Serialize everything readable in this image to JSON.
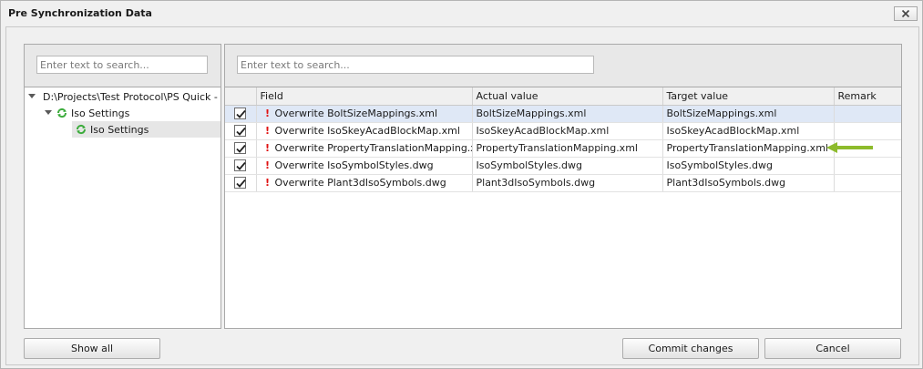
{
  "window": {
    "title": "Pre Synchronization Data"
  },
  "left_pane": {
    "search_placeholder": "Enter text to search...",
    "tree": [
      {
        "label": "D:\\Projects\\Test Protocol\\PS Quick - T",
        "level": 0,
        "expanded": true,
        "icon": "sync-icon"
      },
      {
        "label": "Iso Settings",
        "level": 1,
        "expanded": true,
        "icon": "sync-icon"
      },
      {
        "label": "Iso Settings",
        "level": 2,
        "selected": true,
        "icon": "sync-icon"
      }
    ]
  },
  "right_pane": {
    "search_placeholder": "Enter text to search...",
    "columns": [
      "",
      "Field",
      "Actual value",
      "Target value",
      "Remark"
    ],
    "rows": [
      {
        "checked": true,
        "warning": "!",
        "field": "Overwrite BoltSizeMappings.xml",
        "actual": "BoltSizeMappings.xml",
        "target": "BoltSizeMappings.xml",
        "remark": "",
        "selected": true
      },
      {
        "checked": true,
        "warning": "!",
        "field": "Overwrite IsoSkeyAcadBlockMap.xml",
        "actual": "IsoSkeyAcadBlockMap.xml",
        "target": "IsoSkeyAcadBlockMap.xml",
        "remark": ""
      },
      {
        "checked": true,
        "warning": "!",
        "field": "Overwrite PropertyTranslationMapping.xml",
        "actual": "PropertyTranslationMapping.xml",
        "target": "PropertyTranslationMapping.xml",
        "remark": ""
      },
      {
        "checked": true,
        "warning": "!",
        "field": "Overwrite IsoSymbolStyles.dwg",
        "actual": "IsoSymbolStyles.dwg",
        "target": "IsoSymbolStyles.dwg",
        "remark": ""
      },
      {
        "checked": true,
        "warning": "!",
        "field": "Overwrite Plant3dIsoSymbols.dwg",
        "actual": "Plant3dIsoSymbols.dwg",
        "target": "Plant3dIsoSymbols.dwg",
        "remark": ""
      }
    ]
  },
  "buttons": {
    "show_all": "Show all",
    "commit": "Commit changes",
    "cancel": "Cancel"
  },
  "colors": {
    "warning": "#e01010",
    "sync_icon": "#3bab3b",
    "arrow": "#8dbb2c",
    "selected_row": "#dfe8f6"
  },
  "icons": {
    "close": "close-icon",
    "sync": "sync-icon",
    "expander": "triangle-down-icon",
    "annotation_arrow": "arrow-left-icon"
  }
}
